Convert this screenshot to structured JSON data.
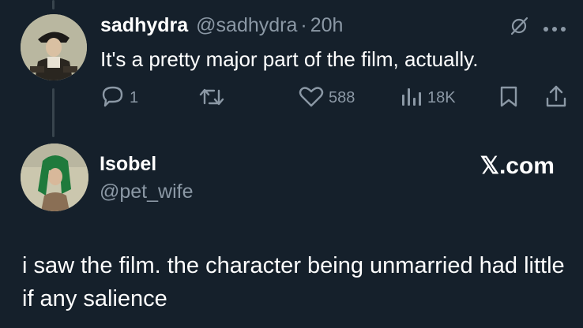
{
  "tweet1": {
    "display_name": "sadhydra",
    "handle": "@sadhydra",
    "separator": "·",
    "time": "20h",
    "text": "It's a pretty major part of the film, actually.",
    "actions": {
      "reply_count": "1",
      "like_count": "588",
      "views_count": "18K"
    },
    "icons": [
      "grok-icon",
      "more-icon",
      "reply-icon",
      "retweet-icon",
      "like-icon",
      "views-icon",
      "bookmark-icon",
      "share-icon"
    ]
  },
  "tweet2": {
    "display_name": "Isobel",
    "handle": "@pet_wife",
    "source": "𝕏.com",
    "text": "i saw the film. the character being unmarried had little if any salience"
  },
  "colors": {
    "background": "#15202b",
    "text": "#ffffff",
    "muted": "#8b98a5",
    "thread_line": "#38444d"
  }
}
